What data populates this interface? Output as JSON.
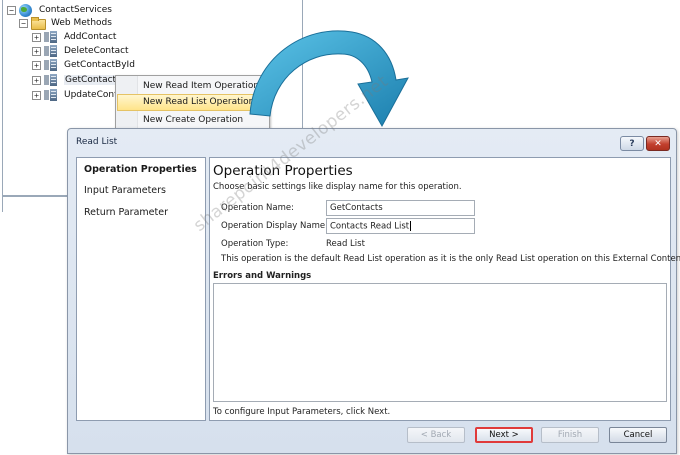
{
  "tree": {
    "root": "ContactServices",
    "folder": "Web Methods",
    "methods": [
      "AddContact",
      "DeleteContact",
      "GetContactById",
      "GetContacts",
      "UpdateCont"
    ],
    "expander_collapsed": "+",
    "expander_expanded": "−"
  },
  "context_menu": {
    "items": [
      "New Read Item Operation",
      "New Read List Operation",
      "New Create Operation"
    ]
  },
  "dialog": {
    "title": "Read List",
    "help_label": "?",
    "close_label": "✕",
    "nav": [
      "Operation Properties",
      "Input Parameters",
      "Return Parameter"
    ],
    "heading": "Operation Properties",
    "description": "Choose basic settings like display name for this operation.",
    "fields": {
      "operation_name": {
        "label": "Operation Name:",
        "value": "GetContacts"
      },
      "display_name": {
        "label": "Operation Display Name:",
        "value": "Contacts Read List"
      },
      "operation_type": {
        "label": "Operation Type:",
        "value": "Read List"
      }
    },
    "note": "This operation is the default Read List operation as it is the only Read List operation on this External Content Type.",
    "errors_heading": "Errors and Warnings",
    "footer": "To configure Input Parameters, click Next.",
    "buttons": {
      "back": "< Back",
      "next": "Next >",
      "finish": "Finish",
      "cancel": "Cancel"
    }
  },
  "watermark": "sharepoint4developers.net",
  "colors": {
    "highlight_border": "#e03a3a",
    "arrow": "#2a97c0"
  }
}
